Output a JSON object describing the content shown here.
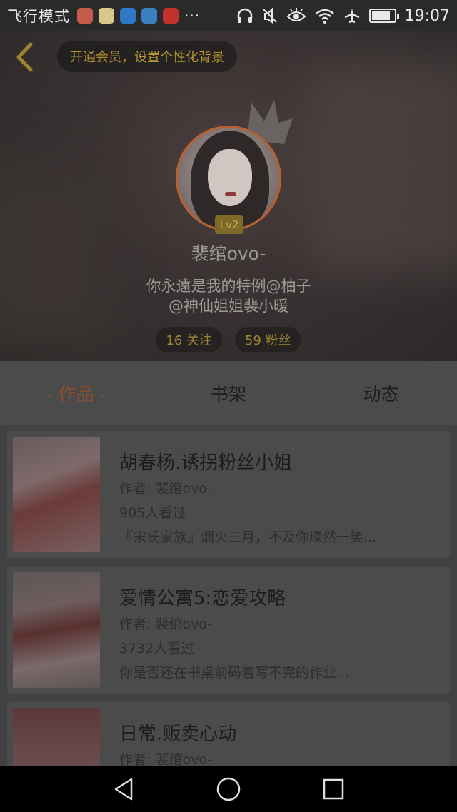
{
  "status_bar": {
    "mode": "飞行模式",
    "more": "···",
    "time": "19:07",
    "notif_icons": [
      "app-red-icon",
      "app-yellow-icon",
      "app-blue-play-icon",
      "qq-icon",
      "huawei-icon"
    ],
    "status_icons": [
      "headphones-icon",
      "mute-icon",
      "eye-icon",
      "wifi-icon",
      "airplane-icon",
      "battery-icon"
    ],
    "battery_level": 0.85
  },
  "header": {
    "back_icon": "chevron-left-icon",
    "vip_banner": "开通会员，设置个性化背景",
    "level": "Lv2",
    "username": "裴绾ovo-",
    "signature_line1": "你永遠是我的特例@柚子",
    "signature_line2": "@神仙姐姐裴小暖",
    "following": "16 关注",
    "followers": "59 粉丝"
  },
  "tabs": [
    {
      "label": "- 作品 -",
      "active": true
    },
    {
      "label": "书架",
      "active": false
    },
    {
      "label": "动态",
      "active": false
    }
  ],
  "works": [
    {
      "title": "胡春杨.诱拐粉丝小姐",
      "author": "作者: 裴绾ovo-",
      "views": "905人看过",
      "desc": "『宋氏家族』烟火三月，不及你璨然一笑..."
    },
    {
      "title": "爱情公寓5:恋爱攻略",
      "author": "作者: 裴绾ovo-",
      "views": "3732人看过",
      "desc": "你是否还在书桌前码着写不完的作业..."
    },
    {
      "title": "日常.贩卖心动",
      "author": "作者: 裴绾ovo-",
      "views": "",
      "desc": ""
    }
  ],
  "colors": {
    "accent": "#8a4e2c",
    "gold": "#b8962e",
    "overlay": "#4b4b4b"
  },
  "nav_icons": [
    "back-triangle-icon",
    "home-circle-icon",
    "recents-square-icon"
  ]
}
